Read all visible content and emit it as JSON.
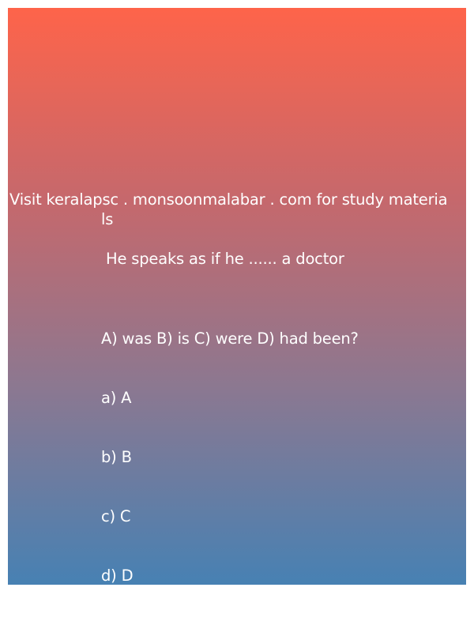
{
  "banner": {
    "line1": "Visit keralapsc . monsoonmalabar . com for study materia",
    "line2": "ls"
  },
  "question": {
    "text": "He speaks as if he ...... a doctor",
    "choices_line": "A) was B) is C) were D) had been?",
    "options": [
      {
        "label": "a) A"
      },
      {
        "label": "b) B"
      },
      {
        "label": "c) C"
      },
      {
        "label": "d) D"
      }
    ]
  },
  "colors": {
    "gradient_top": "#fe644a",
    "gradient_bottom": "#4781b3",
    "text": "#ffffff"
  }
}
